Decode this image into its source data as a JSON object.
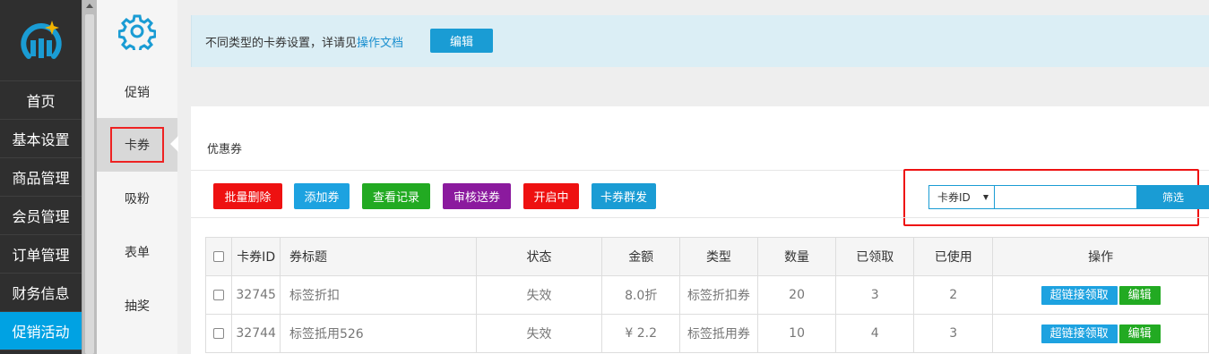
{
  "nav": {
    "items": [
      {
        "label": "首页"
      },
      {
        "label": "基本设置"
      },
      {
        "label": "商品管理"
      },
      {
        "label": "会员管理"
      },
      {
        "label": "订单管理"
      },
      {
        "label": "财务信息"
      },
      {
        "label": "促销活动"
      }
    ],
    "active_index": 6
  },
  "subnav": {
    "items": [
      {
        "label": "促销"
      },
      {
        "label": "卡券"
      },
      {
        "label": "吸粉"
      },
      {
        "label": "表单"
      },
      {
        "label": "抽奖"
      }
    ],
    "active_label": "卡券"
  },
  "info": {
    "text": "不同类型的卡券设置，详请见",
    "link_label": "操作文档",
    "edit_label": "编辑"
  },
  "panel": {
    "title": "优惠券",
    "toolbar": {
      "batch_delete": "批量删除",
      "add_coupon": "添加券",
      "view_records": "查看记录",
      "review_send": "审核送券",
      "enabled": "开启中",
      "mass_send": "卡券群发"
    },
    "filter": {
      "select_value": "卡券ID",
      "input_value": "",
      "button_label": "筛选"
    }
  },
  "table": {
    "headers": [
      "",
      "卡券ID",
      "券标题",
      "状态",
      "金额",
      "类型",
      "数量",
      "已领取",
      "已使用",
      "操作"
    ],
    "rows": [
      {
        "id": "32745",
        "title": "标签折扣",
        "status": "失效",
        "amount": "8.0折",
        "type": "标签折扣券",
        "qty": "20",
        "received": "3",
        "used": "2",
        "link_btn": "超链接领取",
        "edit_btn": "编辑"
      },
      {
        "id": "32744",
        "title": "标签抵用526",
        "status": "失效",
        "amount": "¥ 2.2",
        "type": "标签抵用券",
        "qty": "10",
        "received": "4",
        "used": "3",
        "link_btn": "超链接领取",
        "edit_btn": "编辑"
      }
    ]
  },
  "colors": {
    "nav_bg": "#2f2f2f",
    "accent": "#00a2e3",
    "info_bg": "#dbeef5",
    "red": "#ee1111",
    "green": "#22aa22",
    "purple": "#8b1a9e"
  },
  "icons": {
    "logo": "brand-logo-icon",
    "gear": "gear-icon"
  }
}
